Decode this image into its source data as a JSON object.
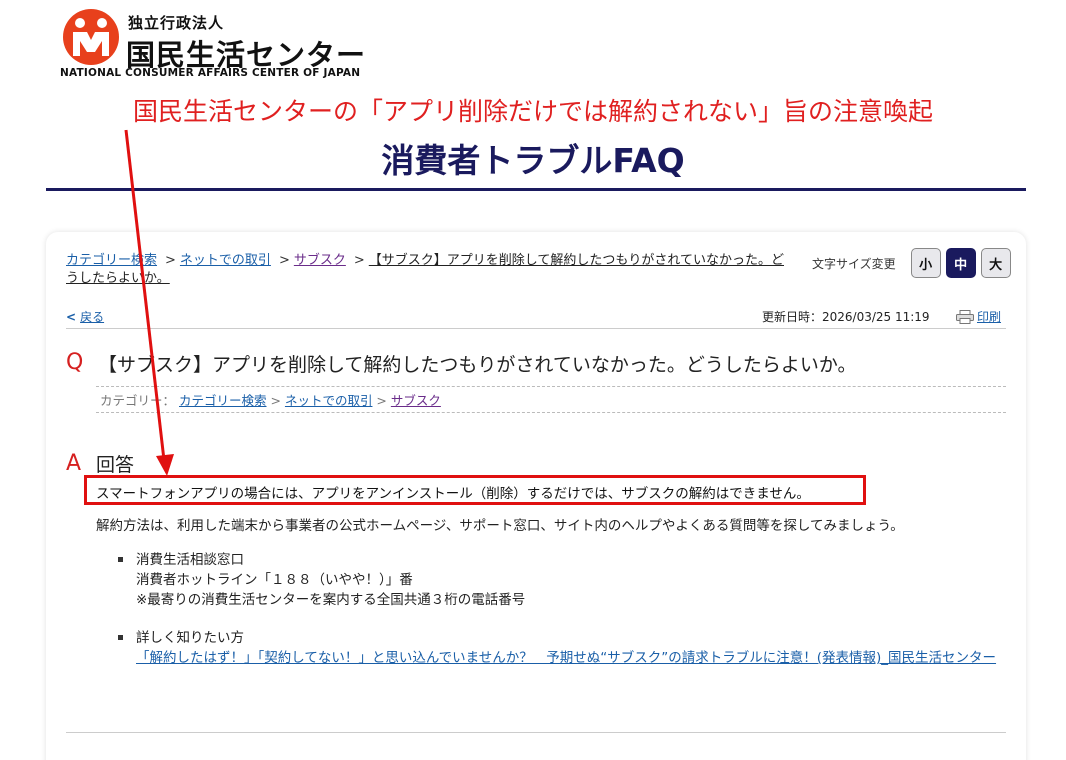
{
  "header": {
    "org_small": "独立行政法人",
    "org_name": "国民生活センター",
    "org_english": "NATIONAL CONSUMER AFFAIRS CENTER OF JAPAN",
    "annotation": "国民生活センターの「アプリ削除だけでは解約されない」旨の注意喚起",
    "title": "消費者トラブルFAQ"
  },
  "breadcrumb": {
    "items": [
      "カテゴリー検索",
      "ネットでの取引",
      "サブスク"
    ],
    "current": "【サブスク】アプリを削除して解約したつもりがされていなかった。どうしたらよいか。",
    "separator": ">"
  },
  "font_size": {
    "label": "文字サイズ変更",
    "small": "小",
    "medium": "中",
    "large": "大"
  },
  "toolbar": {
    "back": "戻る",
    "updated": "更新日時：2026/03/25 11:19",
    "print": "印刷"
  },
  "question": {
    "mark": "Q",
    "text": "【サブスク】アプリを削除して解約したつもりがされていなかった。どうしたらよいか。",
    "category_label": "カテゴリー：",
    "categories": [
      "カテゴリー検索",
      "ネットでの取引",
      "サブスク"
    ]
  },
  "answer": {
    "mark": "A",
    "heading": "回答",
    "line1": "スマートフォンアプリの場合には、アプリをアンインストール（削除）するだけでは、サブスクの解約はできません。",
    "line2": "解約方法は、利用した端末から事業者の公式ホームページ、サポート窓口、サイト内のヘルプやよくある質問等を探してみましょう。",
    "list": [
      {
        "title": "消費生活相談窓口",
        "line2": "消費者ホットライン「１８８（いやや！）」番",
        "line3": "※最寄りの消費生活センターを案内する全国共通３桁の電話番号"
      },
      {
        "title": "詳しく知りたい方",
        "link": "「解約したはず！」「契約してない！」と思い込んでいませんか？　予期せぬ“サブスク”の請求トラブルに注意！(発表情報)_国民生活センター"
      }
    ]
  },
  "colors": {
    "navy": "#1a1a5e",
    "red": "#e02020",
    "link": "#1a5fa8",
    "visited": "#6a2c8a"
  }
}
